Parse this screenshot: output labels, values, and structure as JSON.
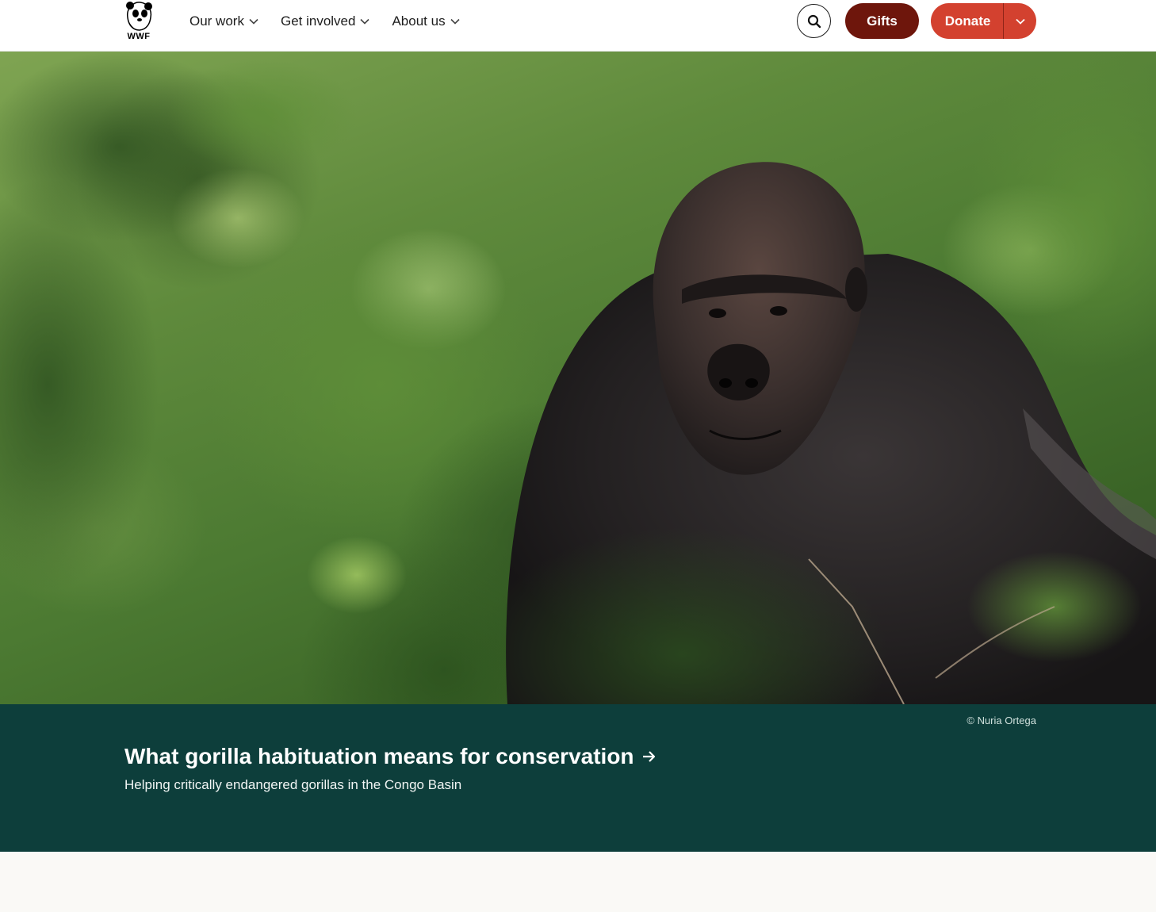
{
  "logo": {
    "text": "WWF",
    "icon": "panda-logo-icon"
  },
  "nav": {
    "items": [
      {
        "label": "Our work",
        "icon": "chevron-down-icon"
      },
      {
        "label": "Get involved",
        "icon": "chevron-down-icon"
      },
      {
        "label": "About us",
        "icon": "chevron-down-icon"
      }
    ]
  },
  "header_actions": {
    "search_icon": "search-icon",
    "gifts_label": "Gifts",
    "donate_label": "Donate",
    "donate_menu_icon": "chevron-down-icon"
  },
  "colors": {
    "gifts_bg": "#6e160c",
    "donate_bg": "#d3412f",
    "band_bg": "#0d3e3b"
  },
  "hero": {
    "credit": "© Nuria Ortega",
    "title": "What gorilla habituation means for conservation",
    "title_icon": "arrow-right-icon",
    "subtitle": "Helping critically endangered gorillas in the Congo Basin"
  }
}
